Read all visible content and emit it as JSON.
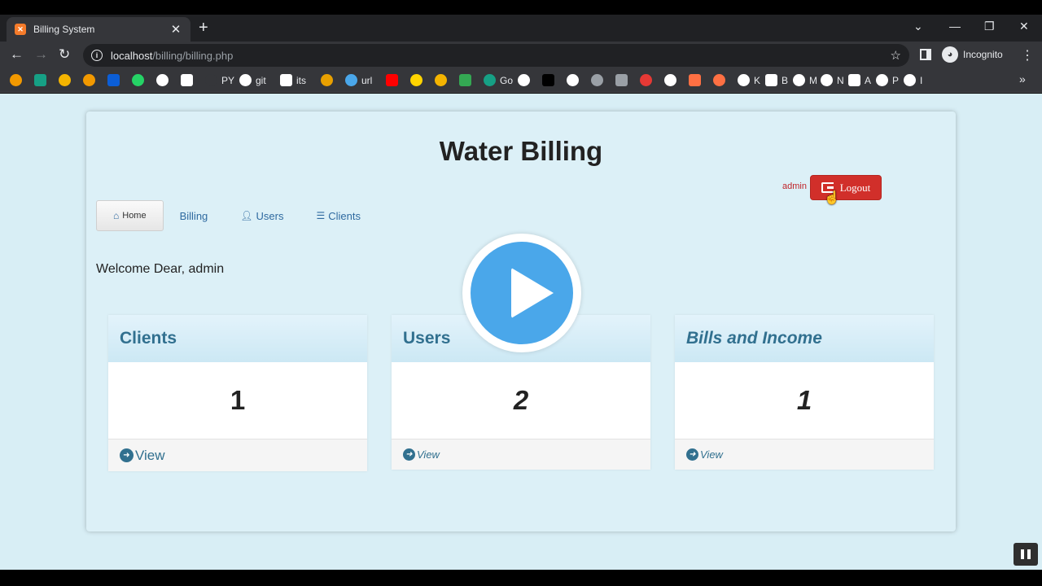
{
  "browser": {
    "tab_title": "Billing System",
    "tab_close": "✕",
    "new_tab": "+",
    "url_host": "localhost",
    "url_path": "/billing/billing.php",
    "profile_label": "Incognito",
    "bookmarks": [
      {
        "label": "",
        "color": "#f29900"
      },
      {
        "label": "",
        "color": "#16a085"
      },
      {
        "label": "",
        "color": "#f4b400"
      },
      {
        "label": "",
        "color": "#f29900"
      },
      {
        "label": "",
        "color": "#0b5ed7"
      },
      {
        "label": "",
        "color": "#25d366"
      },
      {
        "label": "",
        "color": "#ffffff"
      },
      {
        "label": "",
        "color": "#ffffff"
      },
      {
        "label": "PY",
        "color": "#35363a"
      },
      {
        "label": "git",
        "color": "#ffffff"
      },
      {
        "label": "its",
        "color": "#ffffff"
      },
      {
        "label": "",
        "color": "#e8a000"
      },
      {
        "label": "url",
        "color": "#4aa7ea"
      },
      {
        "label": "",
        "color": "#ff0000"
      },
      {
        "label": "",
        "color": "#ffd400"
      },
      {
        "label": "",
        "color": "#f4b400"
      },
      {
        "label": "",
        "color": "#34a853"
      },
      {
        "label": "Go",
        "color": "#16a085"
      },
      {
        "label": "",
        "color": "#ffffff"
      },
      {
        "label": "",
        "color": "#000000"
      },
      {
        "label": "",
        "color": "#ffffff"
      },
      {
        "label": "",
        "color": "#9aa0a6"
      },
      {
        "label": "",
        "color": "#9aa0a6"
      },
      {
        "label": "",
        "color": "#e53935"
      },
      {
        "label": "",
        "color": "#ffffff"
      },
      {
        "label": "",
        "color": "#ff7043"
      },
      {
        "label": "",
        "color": "#ff7043"
      },
      {
        "label": "K",
        "color": "#ffffff"
      },
      {
        "label": "B",
        "color": "#ffffff"
      },
      {
        "label": "M",
        "color": "#ffffff"
      },
      {
        "label": "N",
        "color": "#ffffff"
      },
      {
        "label": "A",
        "color": "#ffffff"
      },
      {
        "label": "P",
        "color": "#ffffff"
      },
      {
        "label": "I",
        "color": "#ffffff"
      }
    ],
    "more_bookmarks": "»"
  },
  "page": {
    "title": "Water Billing",
    "user_label": "admin",
    "logout_label": "Logout",
    "welcome": "Welcome Dear, admin",
    "nav": [
      {
        "label": "Home",
        "icon": "home-icon",
        "active": true
      },
      {
        "label": "Billing",
        "icon": "",
        "active": false
      },
      {
        "label": "Users",
        "icon": "user-icon",
        "active": false
      },
      {
        "label": "Clients",
        "icon": "list-icon",
        "active": false
      }
    ],
    "cards": [
      {
        "title": "Clients",
        "value": "1",
        "link": "View"
      },
      {
        "title": "Users",
        "value": "2",
        "link": "View"
      },
      {
        "title": "Bills and Income",
        "value": "1",
        "link": "View"
      }
    ]
  },
  "colors": {
    "accent": "#31708f",
    "logout": "#d12f2a",
    "page_bg": "#d8eef5",
    "play": "#4aa7ea"
  }
}
